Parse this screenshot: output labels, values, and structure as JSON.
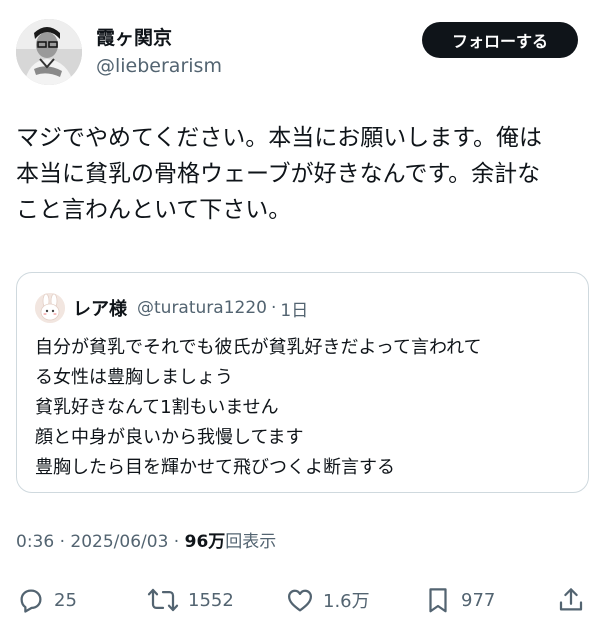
{
  "author": {
    "display_name": "霞ヶ関京",
    "handle": "@lieberarism",
    "follow_label": "フォローする"
  },
  "tweet": {
    "text": "マジでやめてください。本当にお願いします。俺は\n本当に貧乳の骨格ウェーブが好きなんです。余計な\nこと言わんといて下さい。"
  },
  "quote": {
    "display_name": "レア様",
    "handle": "@turatura1220",
    "separator": "·",
    "time": "1日",
    "text": "自分が貧乳でそれでも彼氏が貧乳好きだよって言われて\nる女性は豊胸しましょう\n貧乳好きなんて1割もいません\n顔と中身が良いから我慢してます\n豊胸したら目を輝かせて飛びつくよ断言する"
  },
  "meta": {
    "time": "0:36",
    "sep1": "·",
    "date": "2025/06/03",
    "sep2": "·",
    "views_count": "96万",
    "views_label": "回表示"
  },
  "actions": {
    "replies": "25",
    "reposts": "1552",
    "likes": "1.6万",
    "bookmarks": "977"
  },
  "icons": {
    "reply": "reply-icon",
    "repost": "repost-icon",
    "like": "heart-icon",
    "bookmark": "bookmark-icon",
    "share": "share-icon"
  },
  "colors": {
    "text": "#0f1419",
    "secondary": "#536471",
    "border": "#cfd9de",
    "follow_bg": "#0f1419"
  }
}
